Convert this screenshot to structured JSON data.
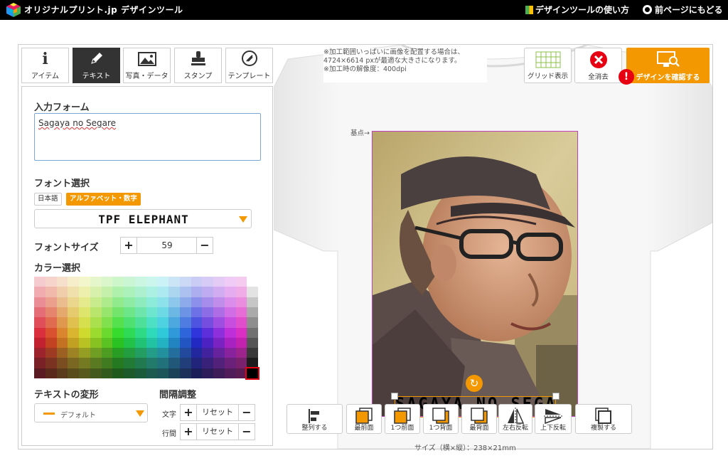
{
  "header": {
    "logo_text": "オリジナルプリント.jp デザインツール",
    "help_link": "デザインツールの使い方",
    "back_link": "前ページにもどる"
  },
  "tabs": [
    {
      "label": "アイテム",
      "icon": "info-icon"
    },
    {
      "label": "テキスト",
      "icon": "pen-icon",
      "active": true
    },
    {
      "label": "写真・データ",
      "icon": "image-icon"
    },
    {
      "label": "スタンプ",
      "icon": "stamp-icon"
    },
    {
      "label": "テンプレート",
      "icon": "template-icon"
    }
  ],
  "text_panel": {
    "input_title": "入力フォーム",
    "input_value": "Sagaya no Segare",
    "font_title": "フォント選択",
    "lang_japanese": "日本語",
    "lang_alphanumeric": "アルファベット・数字",
    "font_name": "TPF ELEPHANT",
    "size_title": "フォントサイズ",
    "font_size": "59",
    "color_title": "カラー選択",
    "transform_title": "テキストの変形",
    "transform_value": "デフォルト",
    "spacing_title": "間隔調整",
    "char_label": "文字",
    "line_label": "行間",
    "reset_label": "リセット"
  },
  "canvas": {
    "notice": [
      "※加工範囲いっぱいに画像を配置する場合は、",
      "4724×6614 pxが最適な大きさになります。",
      "※加工時の解像度：400dpi"
    ],
    "grid_button": "グリッド表示",
    "clear_button": "全消去",
    "confirm_button": "デザインを確認する",
    "base_point": "基点→",
    "text_object": "SAGAYA NO SEGARE",
    "size_info": "サイズ（横×縦）：238×21mm"
  },
  "bottom_toolbar": [
    {
      "label": "整列する",
      "icon": "align-icon"
    },
    {
      "label": "最前面",
      "icon": "bring-front-icon"
    },
    {
      "label": "1つ前面",
      "icon": "bring-forward-icon"
    },
    {
      "label": "1つ背面",
      "icon": "send-backward-icon"
    },
    {
      "label": "最背面",
      "icon": "send-back-icon"
    },
    {
      "label": "左右反転",
      "icon": "flip-horizontal-icon"
    },
    {
      "label": "上下反転",
      "icon": "flip-vertical-icon"
    },
    {
      "label": "複製する",
      "icon": "duplicate-icon"
    }
  ],
  "colors": {
    "accent": "#f39800",
    "alert": "#e60012",
    "active_tab": "#333333",
    "header": "#000000"
  }
}
